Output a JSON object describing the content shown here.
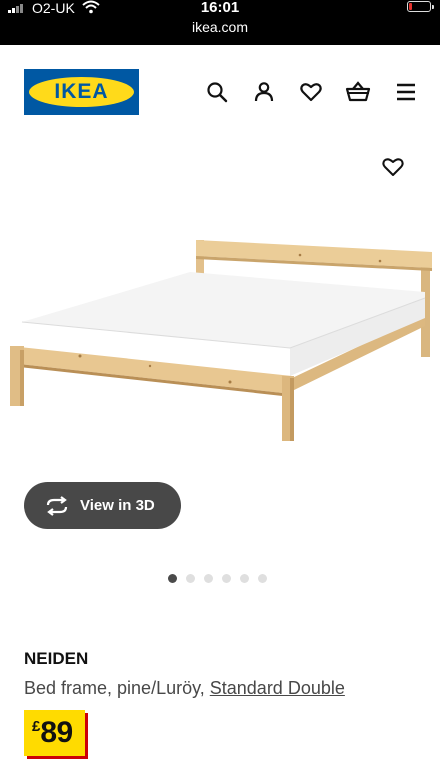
{
  "status_bar": {
    "carrier": "O2-UK",
    "time": "16:01",
    "url": "ikea.com"
  },
  "header": {
    "logo_text": "IKEA",
    "icons": [
      "search-icon",
      "profile-icon",
      "heart-icon",
      "basket-icon",
      "menu-icon"
    ]
  },
  "gallery": {
    "view_3d_label": "View in 3D",
    "dot_count": 6,
    "active_index": 0
  },
  "product": {
    "name": "NEIDEN",
    "description": "Bed frame, pine/Luröy, ",
    "size_link": "Standard Double",
    "currency": "£",
    "price": "89"
  },
  "colors": {
    "ikea_blue": "#0058a3",
    "ikea_yellow": "#ffda1a",
    "price_yellow": "#ffdb00",
    "price_shadow": "#cc0008",
    "button_dark": "#484848"
  }
}
